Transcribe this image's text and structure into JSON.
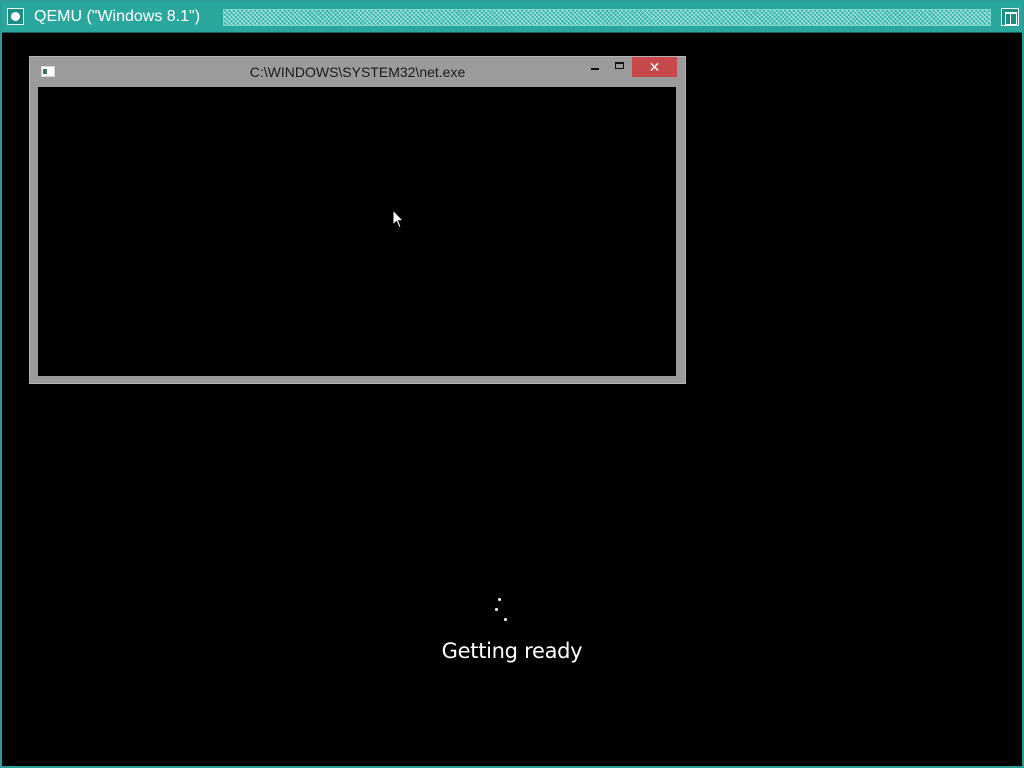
{
  "qemu": {
    "title": "QEMU (\"Windows 8.1\")",
    "icons": {
      "menu": "qemu-system-menu-icon",
      "maximize": "qemu-maximize-icon"
    },
    "colors": {
      "frame": "#2aa79c"
    }
  },
  "console_window": {
    "title": "C:\\WINDOWS\\SYSTEM32\\net.exe",
    "icons": {
      "app": "console-app-icon",
      "minimize": "minimize-icon",
      "maximize": "maximize-icon",
      "close": "close-icon"
    },
    "close_glyph": "✕",
    "colors": {
      "frame": "#9b9b9b",
      "close": "#c7494b"
    }
  },
  "screen": {
    "status_text": "Getting ready",
    "spinner_icon": "loading-spinner-icon",
    "cursor_icon": "mouse-cursor-icon"
  }
}
